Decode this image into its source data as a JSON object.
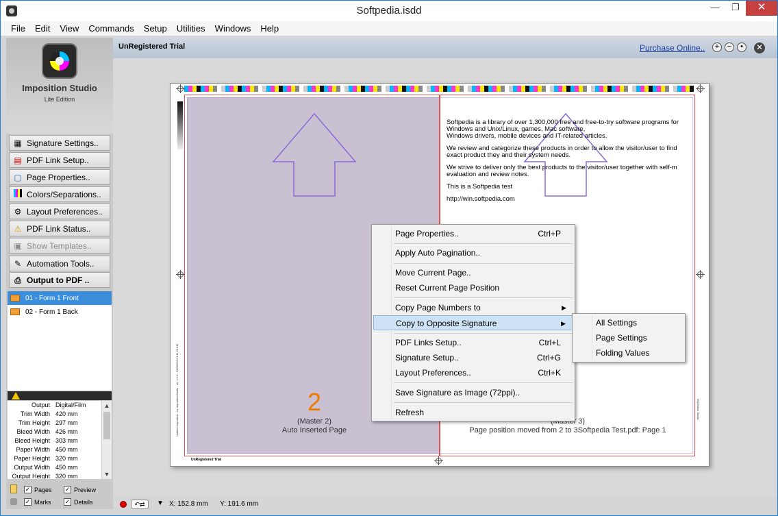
{
  "window": {
    "title": "Softpedia.isdd",
    "min_icon": "—",
    "max_icon": "❐",
    "close_icon": "✕"
  },
  "menu": [
    "File",
    "Edit",
    "View",
    "Commands",
    "Setup",
    "Utilities",
    "Windows",
    "Help"
  ],
  "sidebar": {
    "logo_title": "Imposition Studio",
    "logo_sub": "Lite Edition",
    "buttons": [
      {
        "label": "Signature Settings..",
        "icon": "grid-icon"
      },
      {
        "label": "PDF Link Setup..",
        "icon": "pdf-icon"
      },
      {
        "label": "Page Properties..",
        "icon": "page-icon"
      },
      {
        "label": "Colors/Separations..",
        "icon": "colors-icon"
      },
      {
        "label": "Layout Preferences..",
        "icon": "gear-icon"
      },
      {
        "label": "PDF Link Status..",
        "icon": "warning-icon"
      },
      {
        "label": "Show Templates..",
        "icon": "templates-icon"
      },
      {
        "label": "Automation Tools..",
        "icon": "tools-icon"
      },
      {
        "label": "Output to PDF ..",
        "icon": "printer-icon"
      }
    ],
    "forms": [
      "01 - Form 1 Front",
      "02 - Form 1 Back"
    ],
    "info": [
      {
        "k": "Output",
        "v": "Digital/Film"
      },
      {
        "k": "Trim Width",
        "v": "420 mm"
      },
      {
        "k": "Trim Height",
        "v": "297 mm"
      },
      {
        "k": "Bleed Width",
        "v": "426 mm"
      },
      {
        "k": "Bleed Height",
        "v": "303 mm"
      },
      {
        "k": "Paper Width",
        "v": "450 mm"
      },
      {
        "k": "Paper Height",
        "v": "320 mm"
      },
      {
        "k": "Output Width",
        "v": "450 mm"
      },
      {
        "k": "Output Height",
        "v": "320 mm"
      }
    ],
    "options": {
      "pages": "Pages",
      "preview": "Preview",
      "marks": "Marks",
      "details": "Details"
    }
  },
  "toolbar": {
    "unregistered": "UnRegistered Trial",
    "purchase": "Purchase Online..",
    "zoom_in": "+",
    "zoom_out": "−",
    "zoom_fit": "•",
    "close": "✕"
  },
  "sheet": {
    "left_page_number": "2",
    "left_master": "(Master 2)",
    "left_note": "Auto Inserted Page",
    "right_master": "(Master 3)",
    "right_note": "Page position moved from 2 to 3Softpedia Test.pdf: Page 1",
    "unreg_small": "UnRegistered Trial",
    "vert_left": "Untitled Imposition - by ImpositionStudio - ver 1.1.0 - 20/03/2014 3:11:24 AM",
    "vert_right": "Imposition Studio",
    "text": [
      "Softpedia is a library of over 1,300,000 free and free-to-try software programs for",
      " Windows and Unix/Linux, games, Mac software,",
      "Windows drivers, mobile devices and IT-related articles.",
      "We review and categorize these products in order to allow the visitor/user to find",
      " exact product they and their system needs.",
      "We strive to deliver only the best products to the visitor/user together with self-m",
      " evaluation and review notes.",
      "This is a Softpedia test",
      "http://win.softpedia.com"
    ]
  },
  "context_menu": {
    "items": [
      {
        "label": "Page Properties..",
        "shortcut": "Ctrl+P"
      },
      {
        "label": "Apply Auto Pagination..",
        "shortcut": ""
      },
      {
        "label": "Move Current Page..",
        "shortcut": ""
      },
      {
        "label": "Reset Current Page Position",
        "shortcut": ""
      },
      {
        "label": "Copy Page Numbers to",
        "shortcut": ""
      },
      {
        "label": "Copy to Opposite Signature",
        "shortcut": ""
      },
      {
        "label": "PDF Links Setup..",
        "shortcut": "Ctrl+L"
      },
      {
        "label": "Signature Setup..",
        "shortcut": "Ctrl+G"
      },
      {
        "label": "Layout Preferences..",
        "shortcut": "Ctrl+K"
      },
      {
        "label": "Save Signature as Image (72ppi)..",
        "shortcut": ""
      },
      {
        "label": "Refresh",
        "shortcut": ""
      }
    ],
    "submenu": [
      "All Settings",
      "Page Settings",
      "Folding Values"
    ]
  },
  "status": {
    "x": "X: 152.8 mm",
    "y": "Y: 191.6 mm",
    "nav": "↶⇄",
    "dropdown": "▼"
  },
  "colors": {
    "accent": "#3b8edc",
    "page_left": "#c9c0d1",
    "arrow": "#8a6bd8",
    "trim": "#e05050",
    "page_number": "#f07a00"
  }
}
